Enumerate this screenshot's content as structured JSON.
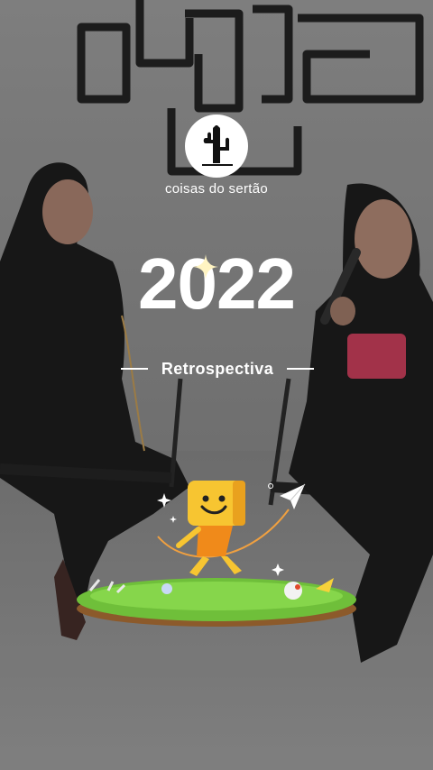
{
  "brand": {
    "name": "coisas do sertão",
    "logo_icon": "cactus-logo-icon"
  },
  "headline": {
    "year": "2022",
    "subtitle": "Retrospectiva"
  },
  "decor": {
    "sparkle_icon": "sparkle-icon",
    "paper_plane_icon": "paper-plane-icon",
    "mascot_icon": "smiley-mascot-icon",
    "grass_island": "grass-island-illustration"
  },
  "colors": {
    "text": "#ffffff",
    "mascot_body": "#f2a01a",
    "grass": "#6fbf3a"
  }
}
